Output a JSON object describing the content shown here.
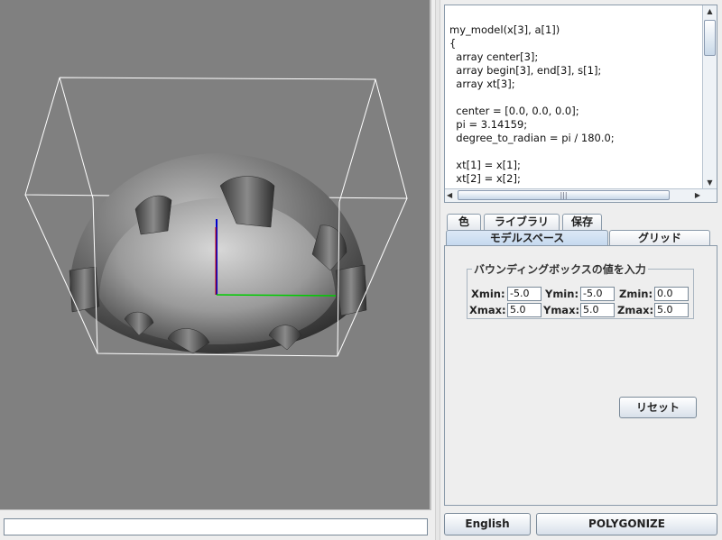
{
  "code_editor": {
    "text": "my_model(x[3], a[1])\n{\n  array center[3];\n  array begin[3], end[3], s[1];\n  array xt[3];\n\n  center = [0.0, 0.0, 0.0];\n  pi = 3.14159;\n  degree_to_radian = pi / 180.0;\n\n  xt[1] = x[1];\n  xt[2] = x[2];"
  },
  "tabs_top": [
    "色",
    "ライブラリ",
    "保存"
  ],
  "tabs_bottom": [
    "モデルスペース",
    "グリッド"
  ],
  "selected_tab": "モデルスペース",
  "bounding_box": {
    "title": "バウンディングボックスの値を入力",
    "xmin_label": "Xmin:",
    "xmin": "-5.0",
    "ymin_label": "Ymin:",
    "ymin": "-5.0",
    "zmin_label": "Zmin:",
    "zmin": "0.0",
    "xmax_label": "Xmax:",
    "xmax": "5.0",
    "ymax_label": "Ymax:",
    "ymax": "5.0",
    "zmax_label": "Zmax:",
    "zmax": "5.0"
  },
  "buttons": {
    "reset": "リセット",
    "language": "English",
    "polygonize": "POLYGONIZE"
  },
  "status_input": {
    "value": ""
  },
  "colors": {
    "viewport_bg": "#808080",
    "axis_x": "#00cc00",
    "axis_y": "#cc0000",
    "axis_z": "#0000cc",
    "bbox_wire": "#ffffff"
  }
}
